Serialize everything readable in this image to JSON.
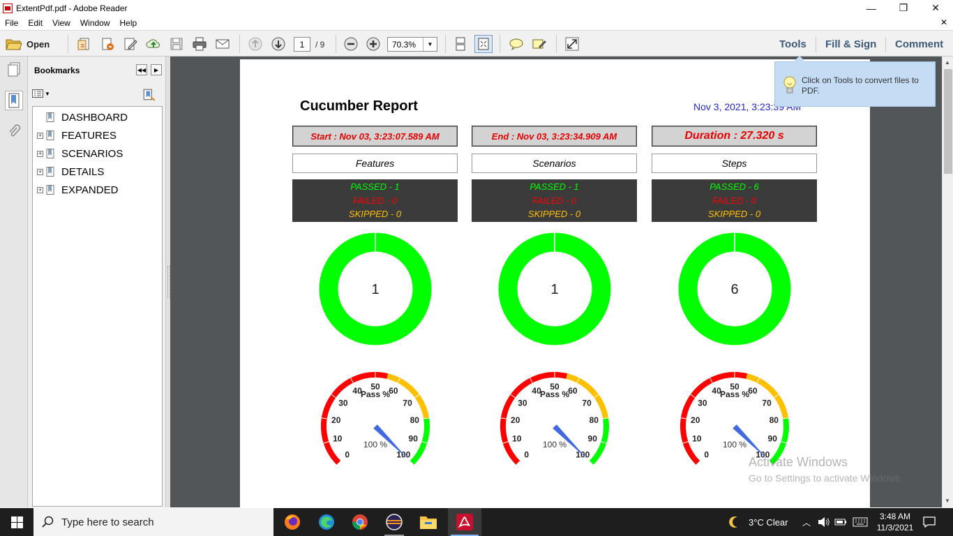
{
  "window": {
    "title": "ExtentPdf.pdf - Adobe Reader",
    "minimize": "—",
    "maximize": "❐",
    "close": "✕"
  },
  "menu": {
    "items": [
      "File",
      "Edit",
      "View",
      "Window",
      "Help"
    ],
    "close": "✕"
  },
  "toolbar": {
    "open_label": "Open",
    "page_current": "1",
    "page_total": "/ 9",
    "zoom": "70.3%",
    "tools": "Tools",
    "fill_sign": "Fill & Sign",
    "comment": "Comment"
  },
  "bookmarks": {
    "header": "Bookmarks",
    "items": [
      {
        "label": "DASHBOARD",
        "expandable": false
      },
      {
        "label": "FEATURES",
        "expandable": true
      },
      {
        "label": "SCENARIOS",
        "expandable": true
      },
      {
        "label": "DETAILS",
        "expandable": true
      },
      {
        "label": "EXPANDED",
        "expandable": true
      }
    ]
  },
  "report": {
    "title": "Cucumber Report",
    "date": "Nov 3, 2021, 3:23:39 AM",
    "start": "Start : Nov 03, 3:23:07.589 AM",
    "end": "End : Nov 03, 3:23:34.909 AM",
    "duration": "Duration : 27.320 s",
    "sections": [
      {
        "name": "Features",
        "passed": "PASSED - 1",
        "failed": "FAILED - 0",
        "skipped": "SKIPPED - 0",
        "total": "1",
        "pass_pct": 100
      },
      {
        "name": "Scenarios",
        "passed": "PASSED - 1",
        "failed": "FAILED - 0",
        "skipped": "SKIPPED - 0",
        "total": "1",
        "pass_pct": 100
      },
      {
        "name": "Steps",
        "passed": "PASSED - 6",
        "failed": "FAILED - 0",
        "skipped": "SKIPPED - 0",
        "total": "6",
        "pass_pct": 100
      }
    ],
    "gauge": {
      "title": "Pass %",
      "readout": "100 %",
      "ticks": [
        "0",
        "10",
        "20",
        "30",
        "40",
        "50",
        "60",
        "70",
        "80",
        "90",
        "100"
      ]
    }
  },
  "tooltip": {
    "text": "Click on Tools to convert files to PDF."
  },
  "watermark": {
    "line1": "Activate Windows",
    "line2": "Go to Settings to activate Windows."
  },
  "taskbar": {
    "search_placeholder": "Type here to search",
    "weather": "3°C  Clear",
    "time": "3:48 AM",
    "date": "11/3/2021"
  },
  "colors": {
    "pass": "#00ff00",
    "fail": "#ff0000",
    "skip": "#ffc000",
    "date_blue": "#2323d5",
    "needle": "#4169e1"
  }
}
